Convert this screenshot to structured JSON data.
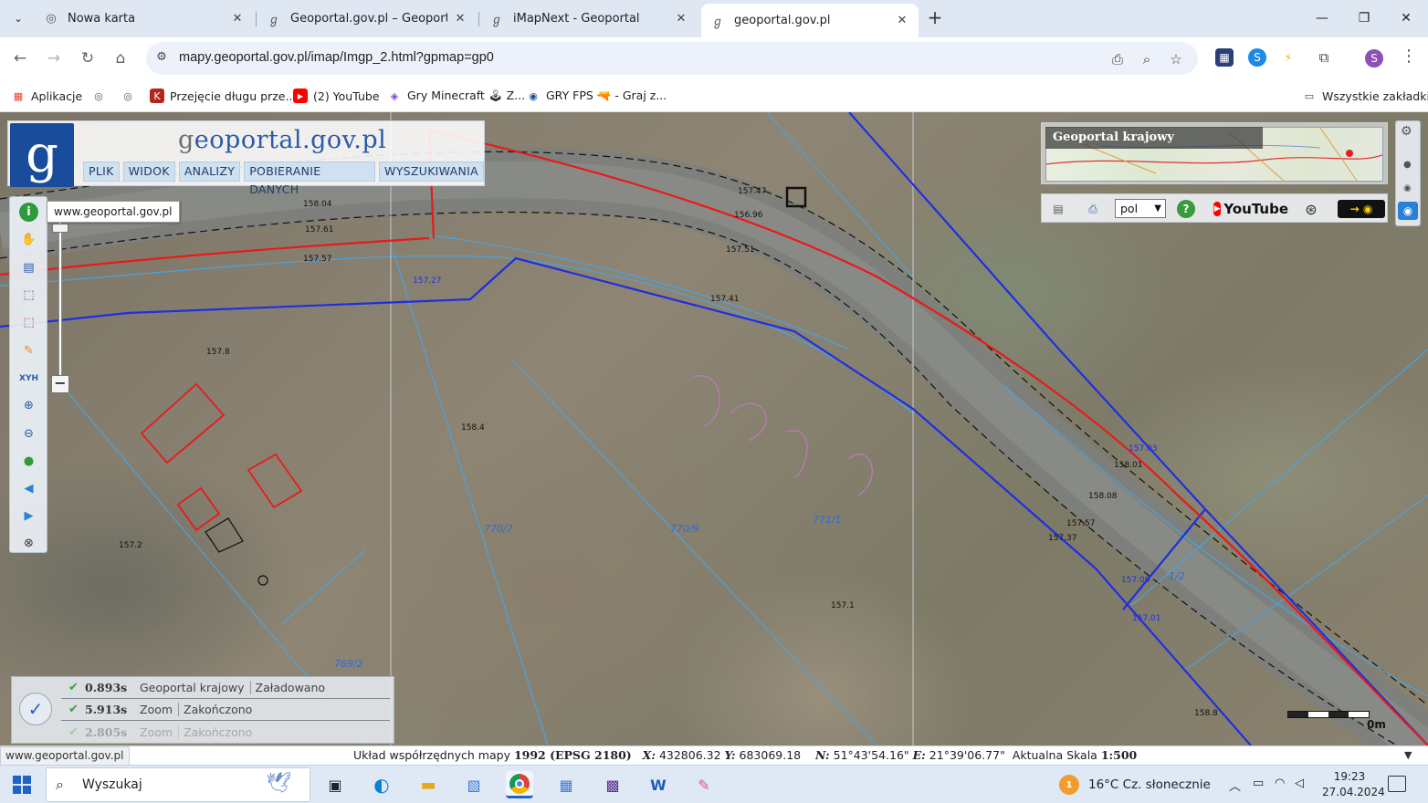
{
  "browser": {
    "tabs": [
      {
        "title": "Nowa karta",
        "icon": "globe-icon",
        "active": false
      },
      {
        "title": "Geoportal.gov.pl – Geoportal Ir",
        "icon": "geoportal-favicon",
        "active": false
      },
      {
        "title": "iMapNext - Geoportal",
        "icon": "geoportal-favicon",
        "active": false
      },
      {
        "title": "geoportal.gov.pl",
        "icon": "geoportal-favicon",
        "active": true
      }
    ],
    "url": "mapy.geoportal.gov.pl/imap/Imgp_2.html?gpmap=gp0",
    "profile_initial": "S",
    "bookmarks": [
      {
        "label": "Aplikacje",
        "icon": "apps-grid-icon"
      },
      {
        "label": "",
        "icon": "globe-icon"
      },
      {
        "label": "",
        "icon": "globe-icon"
      },
      {
        "label": "Przejęcie długu prze...",
        "icon": "bookmark-icon"
      },
      {
        "label": "(2) YouTube",
        "icon": "youtube-icon"
      },
      {
        "label": "Gry Minecraft 🕹 Z...",
        "icon": "twitch-icon"
      },
      {
        "label": "GRY FPS 🔫 - Graj z...",
        "icon": "target-icon"
      }
    ],
    "all_bookmarks": "Wszystkie zakładki"
  },
  "geoportal": {
    "logo_letter": "g",
    "brand_prefix": "g",
    "brand_rest": "eoportal.gov.pl",
    "menu": [
      "PLIK",
      "WIDOK",
      "ANALIZY",
      "POBIERANIE DANYCH",
      "WYSZUKIWANIA"
    ],
    "tooltip": "www.geoportal.gov.pl",
    "nav_title": "Geoportal krajowy",
    "language": "pol",
    "youtube_label": "YouTube",
    "scale_label": "0m",
    "loading": [
      {
        "time": "0.893s",
        "name": "Geoportal krajowy",
        "state": "Załadowano"
      },
      {
        "time": "5.913s",
        "name": "Zoom",
        "state": "Zakończono"
      },
      {
        "time": "2.805s",
        "name": "Zoom",
        "state": "Zakończono"
      }
    ],
    "map_labels": [
      "769/2",
      "770/7",
      "770/9",
      "771/1",
      "1/2",
      "158.04",
      "157.61",
      "157.57",
      "157.47",
      "157.51",
      "157.41",
      "157.27",
      "157.8",
      "158.4",
      "157.2",
      "157.1",
      "157.03",
      "158.01",
      "158.08",
      "157.57",
      "157.37",
      "157.06",
      "157.01",
      "158.8",
      "156.96"
    ]
  },
  "status": {
    "url": "www.geoportal.gov.pl",
    "coords_label": "Układ współrzędnych mapy",
    "coords_system": "1992 (EPSG 2180)",
    "x_label": "X:",
    "x_value": "432806.32",
    "y_label": "Y:",
    "y_value": "683069.18",
    "n_label": "N:",
    "n_value": "51°43'54.16\"",
    "e_label": "E:",
    "e_value": "21°39'06.77\"",
    "scale_label": "Aktualna Skala",
    "scale_value": "1:500"
  },
  "taskbar": {
    "search": "Wyszukaj",
    "weather": "16°C  Cz. słonecznie",
    "weather_badge": "1",
    "time": "19:23",
    "date": "27.04.2024"
  },
  "colors": {
    "parcel_blue": "#1f2fe0",
    "parcel_thin": "#4aa3df",
    "red_line": "#e81a1a",
    "road": "#7d7f7d",
    "accent": "#1a4c9c"
  }
}
